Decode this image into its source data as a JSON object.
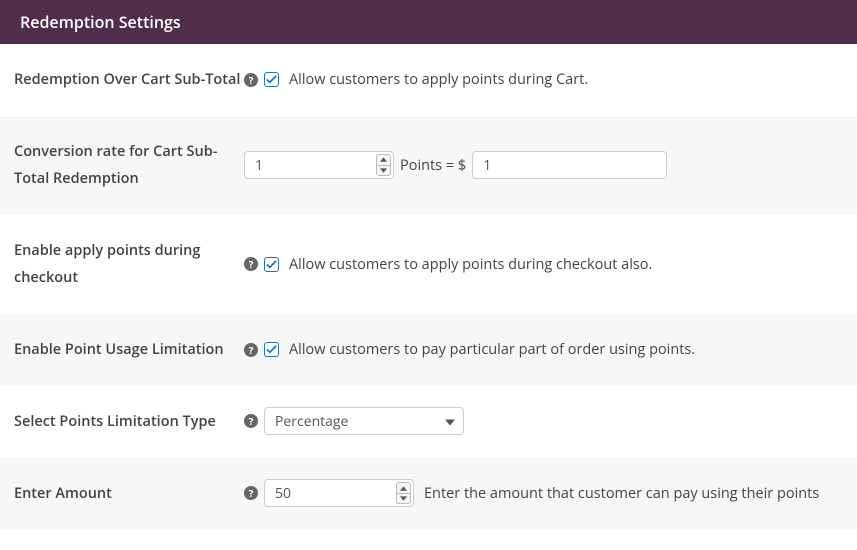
{
  "header": {
    "title": "Redemption Settings"
  },
  "rows": {
    "redemption_over": {
      "label": "Redemption Over Cart Sub-Total",
      "checked": true,
      "desc": "Allow customers to apply points during Cart."
    },
    "conversion_rate": {
      "label": "Conversion rate for Cart Sub-Total Redemption",
      "points_value": "1",
      "mid_text": "Points = $",
      "currency_value": "1"
    },
    "enable_checkout": {
      "label": "Enable apply points during checkout",
      "checked": true,
      "desc": "Allow customers to apply points during checkout also."
    },
    "enable_limitation": {
      "label": "Enable Point Usage Limitation",
      "checked": true,
      "desc": "Allow customers to pay particular part of order using points."
    },
    "limitation_type": {
      "label": "Select Points Limitation Type",
      "selected": "Percentage"
    },
    "enter_amount": {
      "label": "Enter Amount",
      "value": "50",
      "desc": "Enter the amount that customer can pay using their points"
    }
  }
}
